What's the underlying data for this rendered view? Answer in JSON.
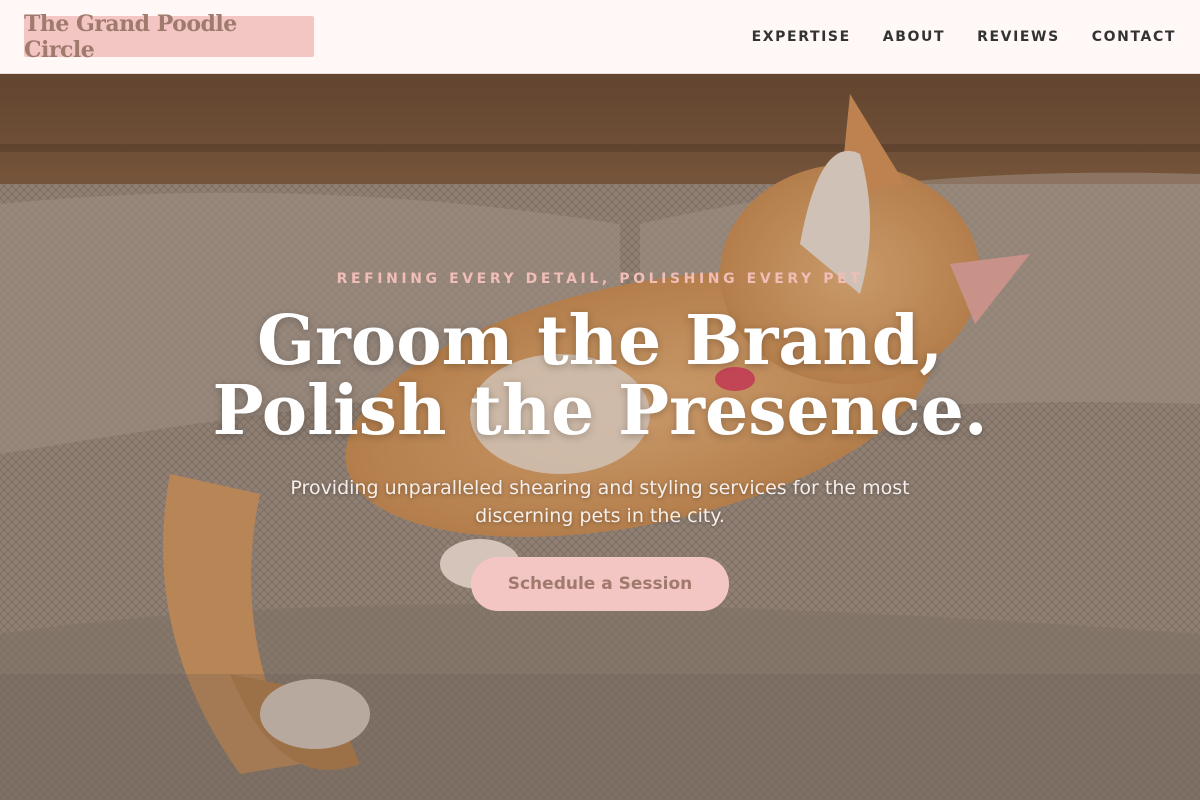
{
  "nav": {
    "brand": "The Grand Poodle Circle",
    "links": [
      "EXPERTISE",
      "ABOUT",
      "REVIEWS",
      "CONTACT"
    ]
  },
  "hero": {
    "eyebrow": "REFINING EVERY DETAIL, POLISHING EVERY PET",
    "headline_line1": "Groom the Brand,",
    "headline_line2": "Polish the Presence.",
    "subtitle": "Providing unparalleled shearing and styling services for the most discerning pets in the city.",
    "cta_label": "Schedule a Session"
  },
  "colors": {
    "accent_pink": "#f3c6c3",
    "brand_text": "#a07a6c",
    "eyebrow": "#f1bdb7"
  }
}
